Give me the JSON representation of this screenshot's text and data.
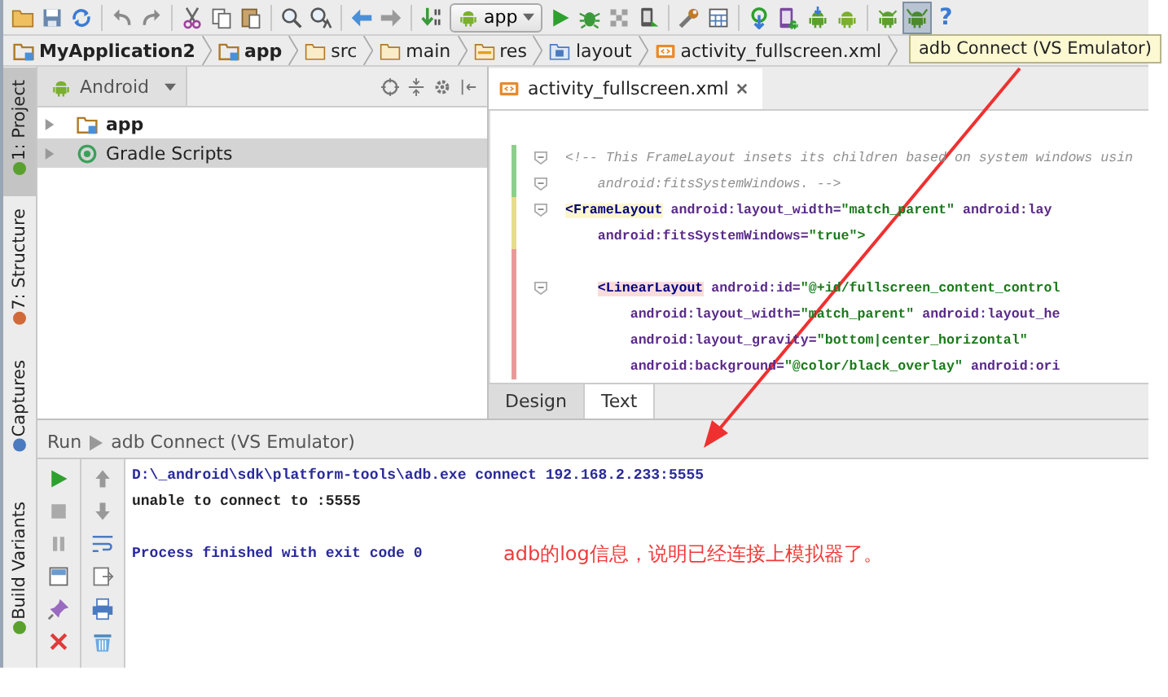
{
  "toolbar": {
    "items": [
      {
        "kind": "open",
        "selected": false
      },
      {
        "kind": "save",
        "selected": false
      },
      {
        "kind": "sync",
        "selected": false
      },
      {
        "kind": "separator"
      },
      {
        "kind": "undo",
        "selected": false
      },
      {
        "kind": "redo",
        "selected": false
      },
      {
        "kind": "separator"
      },
      {
        "kind": "cut",
        "selected": false
      },
      {
        "kind": "copy",
        "selected": false
      },
      {
        "kind": "paste",
        "selected": false
      },
      {
        "kind": "separator"
      },
      {
        "kind": "find",
        "selected": false
      },
      {
        "kind": "replace",
        "selected": false
      },
      {
        "kind": "separator"
      },
      {
        "kind": "back",
        "selected": false
      },
      {
        "kind": "forward",
        "selected": false
      },
      {
        "kind": "separator"
      },
      {
        "kind": "make",
        "selected": false
      },
      {
        "kind": "config",
        "label": "app"
      },
      {
        "kind": "run",
        "selected": false
      },
      {
        "kind": "debug",
        "selected": false
      },
      {
        "kind": "coverage",
        "selected": false
      },
      {
        "kind": "device",
        "selected": false
      },
      {
        "kind": "separator"
      },
      {
        "kind": "wrench",
        "selected": false
      },
      {
        "kind": "structure",
        "selected": false
      },
      {
        "kind": "separator"
      },
      {
        "kind": "gradle",
        "selected": false
      },
      {
        "kind": "avd",
        "selected": false
      },
      {
        "kind": "sdk",
        "selected": false
      },
      {
        "kind": "android",
        "selected": false
      },
      {
        "kind": "separator"
      },
      {
        "kind": "monitor",
        "selected": false
      },
      {
        "kind": "adb",
        "selected": true
      },
      {
        "kind": "help",
        "label": "?"
      }
    ]
  },
  "tooltip": {
    "text": "adb Connect (VS Emulator)"
  },
  "breadcrumb": [
    {
      "label": "MyApplication2",
      "bold": true,
      "kind": "module"
    },
    {
      "label": "app",
      "bold": true,
      "kind": "module"
    },
    {
      "label": "src",
      "bold": false,
      "kind": "folder"
    },
    {
      "label": "main",
      "bold": false,
      "kind": "folder"
    },
    {
      "label": "res",
      "bold": false,
      "kind": "res"
    },
    {
      "label": "layout",
      "bold": false,
      "kind": "layout"
    },
    {
      "label": "activity_fullscreen.xml",
      "bold": false,
      "kind": "xml"
    }
  ],
  "side_tabs_top": [
    {
      "label": "1: Project",
      "selected": true,
      "kind": "project"
    },
    {
      "label": "7: Structure",
      "selected": false,
      "kind": "structure"
    },
    {
      "label": "Captures",
      "selected": false,
      "kind": "captures"
    }
  ],
  "side_tabs_bottom": [
    {
      "label": "Build Variants",
      "selected": false,
      "kind": "variants"
    }
  ],
  "project_panel": {
    "view": "Android",
    "tree": [
      {
        "label": "app",
        "bold": true,
        "selected": false,
        "expanded": false,
        "kind": "module"
      },
      {
        "label": "Gradle Scripts",
        "bold": false,
        "selected": true,
        "expanded": false,
        "kind": "gradle"
      }
    ]
  },
  "editor": {
    "tabs": [
      {
        "label": "activity_fullscreen.xml",
        "selected": true
      }
    ],
    "lines": [
      {
        "kind": "code",
        "color": "#8ccf8c",
        "fold": true,
        "segments": [
          {
            "kind": "comment",
            "text": "<!-- This FrameLayout insets its children based on system windows usin"
          }
        ]
      },
      {
        "kind": "code",
        "color": "#8ccf8c",
        "fold": true,
        "segments": [
          {
            "kind": "comment",
            "text": "    android:fitsSystemWindows. -->"
          }
        ]
      },
      {
        "kind": "code",
        "color": "#e6dc90",
        "fold": true,
        "segments": [
          {
            "kind": "tag_matched",
            "text": "<FrameLayout"
          },
          {
            "kind": "attr",
            "text": " android:layout_width="
          },
          {
            "kind": "value",
            "text": "\"match_parent\""
          },
          {
            "kind": "attr",
            "text": " android:lay"
          }
        ]
      },
      {
        "kind": "code",
        "color": "#e6dc90",
        "fold": false,
        "segments": [
          {
            "kind": "attr",
            "text": "    android:fitsSystemWindows="
          },
          {
            "kind": "value",
            "text": "\"true\">"
          }
        ]
      },
      {
        "kind": "blank",
        "color": "#e89a9a"
      },
      {
        "kind": "code",
        "color": "#e89a9a",
        "fold": true,
        "segments": [
          {
            "kind": "tag_unmatched",
            "text": "    <LinearLayout"
          },
          {
            "kind": "attr",
            "text": " android:id="
          },
          {
            "kind": "value",
            "text": "\"@+id/fullscreen_content_control"
          }
        ]
      },
      {
        "kind": "code",
        "color": "#e89a9a",
        "fold": false,
        "segments": [
          {
            "kind": "attr",
            "text": "        android:layout_width="
          },
          {
            "kind": "value",
            "text": "\"match_parent\""
          },
          {
            "kind": "attr",
            "text": " android:layout_he"
          }
        ]
      },
      {
        "kind": "code",
        "color": "#e89a9a",
        "fold": false,
        "segments": [
          {
            "kind": "attr",
            "text": "        android:layout_gravity="
          },
          {
            "kind": "value",
            "text": "\"bottom|center_horizontal\""
          }
        ]
      },
      {
        "kind": "code",
        "color": "#e89a9a",
        "fold": false,
        "segments": [
          {
            "kind": "attr",
            "text": "        android:background="
          },
          {
            "kind": "value",
            "text": "\"@color/black_overlay\""
          },
          {
            "kind": "attr",
            "text": " android:ori"
          }
        ]
      }
    ],
    "view_tabs": [
      {
        "label": "Design",
        "selected": false
      },
      {
        "label": "Text",
        "selected": true
      }
    ]
  },
  "run_panel": {
    "label": "Run",
    "config": "adb Connect (VS Emulator)",
    "console": [
      {
        "kind": "command",
        "text": "D:\\_android\\sdk\\platform-tools\\adb.exe connect 192.168.2.233:5555"
      },
      {
        "kind": "output",
        "text": "unable to connect to :5555"
      },
      {
        "kind": "blank"
      },
      {
        "kind": "info",
        "text": "Process finished with exit code 0"
      }
    ]
  },
  "annotation": {
    "text": "adb的log信息，说明已经连接上模拟器了。"
  }
}
